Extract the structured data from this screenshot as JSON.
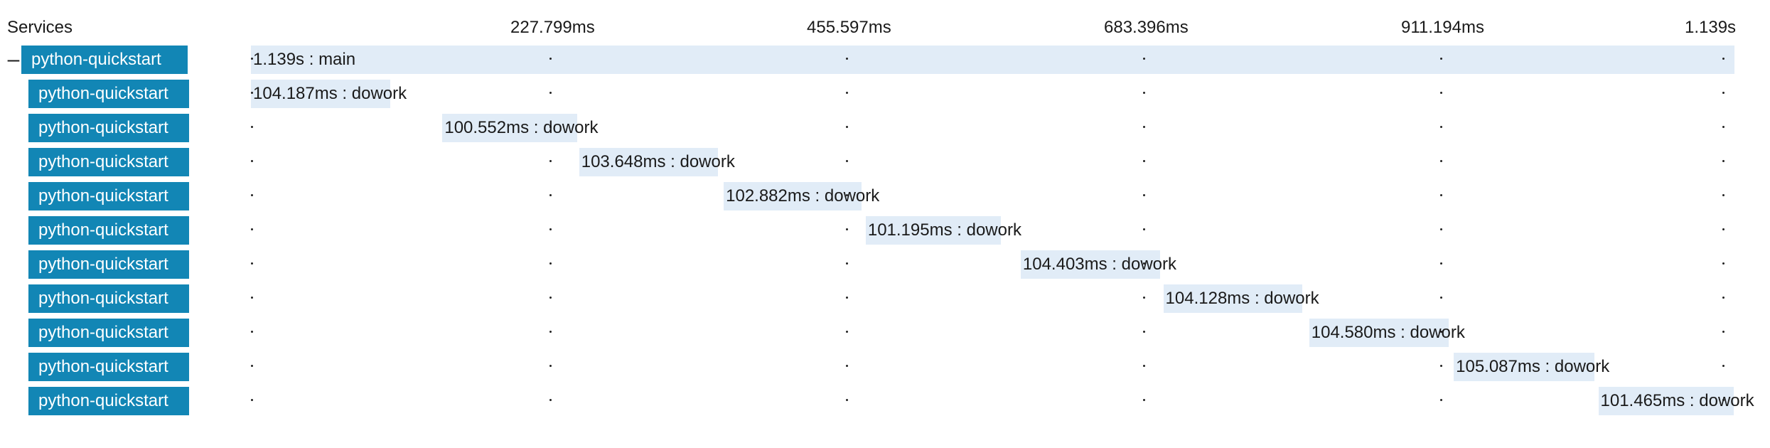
{
  "header": {
    "services_label": "Services"
  },
  "timeline": {
    "ticks": [
      "227.799ms",
      "455.597ms",
      "683.396ms",
      "911.194ms",
      "1.139s"
    ]
  },
  "rows": [
    {
      "service": "python-quickstart",
      "label": "1.139s : main",
      "start_ms": 0,
      "duration_ms": 1139,
      "expandable": true,
      "toggle": "–"
    },
    {
      "service": "python-quickstart",
      "label": "104.187ms : dowork",
      "start_ms": 0,
      "duration_ms": 104.187
    },
    {
      "service": "python-quickstart",
      "label": "100.552ms : dowork",
      "start_ms": 147.0,
      "duration_ms": 100.552
    },
    {
      "service": "python-quickstart",
      "label": "103.648ms : dowork",
      "start_ms": 252.0,
      "duration_ms": 103.648
    },
    {
      "service": "python-quickstart",
      "label": "102.882ms : dowork",
      "start_ms": 363.0,
      "duration_ms": 102.882
    },
    {
      "service": "python-quickstart",
      "label": "101.195ms : dowork",
      "start_ms": 472.0,
      "duration_ms": 101.195
    },
    {
      "service": "python-quickstart",
      "label": "104.403ms : dowork",
      "start_ms": 591.0,
      "duration_ms": 104.403
    },
    {
      "service": "python-quickstart",
      "label": "104.128ms : dowork",
      "start_ms": 700.5,
      "duration_ms": 104.128
    },
    {
      "service": "python-quickstart",
      "label": "104.580ms : dowork",
      "start_ms": 812.5,
      "duration_ms": 104.58
    },
    {
      "service": "python-quickstart",
      "label": "105.087ms : dowork",
      "start_ms": 923.5,
      "duration_ms": 105.087
    },
    {
      "service": "python-quickstart",
      "label": "101.465ms : dowork",
      "start_ms": 1034.5,
      "duration_ms": 101.465
    }
  ],
  "colors": {
    "service_bg": "#1286b5",
    "span_bg": "#e1ecf7"
  }
}
